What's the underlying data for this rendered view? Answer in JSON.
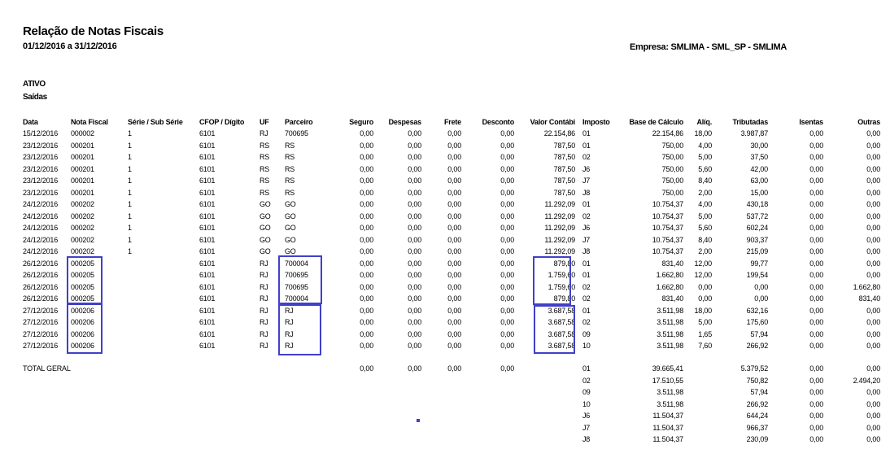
{
  "report": {
    "title": "Relação de Notas Fiscais",
    "period": "01/12/2016 a 31/12/2016",
    "company": "Empresa: SMLIMA - SML_SP - SMLIMA",
    "section": "ATIVO",
    "subsection": "Saídas"
  },
  "table": {
    "columns": [
      "Data",
      "Nota Fiscal",
      "Série / Sub Série",
      "CFOP / Dígito",
      "UF",
      "Parceiro",
      "Seguro",
      "Despesas",
      "Frete",
      "Desconto",
      "Valor Contábi",
      "Imposto",
      "Base de Cálculo",
      "Alíq.",
      "Tributadas",
      "Isentas",
      "Outras"
    ],
    "rows": [
      [
        "15/12/2016",
        "000002",
        "1",
        "6101",
        "RJ",
        "700695",
        "0,00",
        "0,00",
        "0,00",
        "0,00",
        "22.154,86",
        "01",
        "22.154,86",
        "18,00",
        "3.987,87",
        "0,00",
        "0,00"
      ],
      [
        "23/12/2016",
        "000201",
        "1",
        "6101",
        "RS",
        "RS",
        "0,00",
        "0,00",
        "0,00",
        "0,00",
        "787,50",
        "01",
        "750,00",
        "4,00",
        "30,00",
        "0,00",
        "0,00"
      ],
      [
        "23/12/2016",
        "000201",
        "1",
        "6101",
        "RS",
        "RS",
        "0,00",
        "0,00",
        "0,00",
        "0,00",
        "787,50",
        "02",
        "750,00",
        "5,00",
        "37,50",
        "0,00",
        "0,00"
      ],
      [
        "23/12/2016",
        "000201",
        "1",
        "6101",
        "RS",
        "RS",
        "0,00",
        "0,00",
        "0,00",
        "0,00",
        "787,50",
        "J6",
        "750,00",
        "5,60",
        "42,00",
        "0,00",
        "0,00"
      ],
      [
        "23/12/2016",
        "000201",
        "1",
        "6101",
        "RS",
        "RS",
        "0,00",
        "0,00",
        "0,00",
        "0,00",
        "787,50",
        "J7",
        "750,00",
        "8,40",
        "63,00",
        "0,00",
        "0,00"
      ],
      [
        "23/12/2016",
        "000201",
        "1",
        "6101",
        "RS",
        "RS",
        "0,00",
        "0,00",
        "0,00",
        "0,00",
        "787,50",
        "J8",
        "750,00",
        "2,00",
        "15,00",
        "0,00",
        "0,00"
      ],
      [
        "24/12/2016",
        "000202",
        "1",
        "6101",
        "GO",
        "GO",
        "0,00",
        "0,00",
        "0,00",
        "0,00",
        "11.292,09",
        "01",
        "10.754,37",
        "4,00",
        "430,18",
        "0,00",
        "0,00"
      ],
      [
        "24/12/2016",
        "000202",
        "1",
        "6101",
        "GO",
        "GO",
        "0,00",
        "0,00",
        "0,00",
        "0,00",
        "11.292,09",
        "02",
        "10.754,37",
        "5,00",
        "537,72",
        "0,00",
        "0,00"
      ],
      [
        "24/12/2016",
        "000202",
        "1",
        "6101",
        "GO",
        "GO",
        "0,00",
        "0,00",
        "0,00",
        "0,00",
        "11.292,09",
        "J6",
        "10.754,37",
        "5,60",
        "602,24",
        "0,00",
        "0,00"
      ],
      [
        "24/12/2016",
        "000202",
        "1",
        "6101",
        "GO",
        "GO",
        "0,00",
        "0,00",
        "0,00",
        "0,00",
        "11.292,09",
        "J7",
        "10.754,37",
        "8,40",
        "903,37",
        "0,00",
        "0,00"
      ],
      [
        "24/12/2016",
        "000202",
        "1",
        "6101",
        "GO",
        "GO",
        "0,00",
        "0,00",
        "0,00",
        "0,00",
        "11.292,09",
        "J8",
        "10.754,37",
        "2,00",
        "215,09",
        "0,00",
        "0,00"
      ],
      [
        "26/12/2016",
        "000205",
        "",
        "6101",
        "RJ",
        "700004",
        "0,00",
        "0,00",
        "0,00",
        "0,00",
        "879,80",
        "01",
        "831,40",
        "12,00",
        "99,77",
        "0,00",
        "0,00"
      ],
      [
        "26/12/2016",
        "000205",
        "",
        "6101",
        "RJ",
        "700695",
        "0,00",
        "0,00",
        "0,00",
        "0,00",
        "1.759,60",
        "01",
        "1.662,80",
        "12,00",
        "199,54",
        "0,00",
        "0,00"
      ],
      [
        "26/12/2016",
        "000205",
        "",
        "6101",
        "RJ",
        "700695",
        "0,00",
        "0,00",
        "0,00",
        "0,00",
        "1.759,60",
        "02",
        "1.662,80",
        "0,00",
        "0,00",
        "0,00",
        "1.662,80"
      ],
      [
        "26/12/2016",
        "000205",
        "",
        "6101",
        "RJ",
        "700004",
        "0,00",
        "0,00",
        "0,00",
        "0,00",
        "879,80",
        "02",
        "831,40",
        "0,00",
        "0,00",
        "0,00",
        "831,40"
      ],
      [
        "27/12/2016",
        "000206",
        "",
        "6101",
        "RJ",
        "RJ",
        "0,00",
        "0,00",
        "0,00",
        "0,00",
        "3.687,58",
        "01",
        "3.511,98",
        "18,00",
        "632,16",
        "0,00",
        "0,00"
      ],
      [
        "27/12/2016",
        "000206",
        "",
        "6101",
        "RJ",
        "RJ",
        "0,00",
        "0,00",
        "0,00",
        "0,00",
        "3.687,58",
        "02",
        "3.511,98",
        "5,00",
        "175,60",
        "0,00",
        "0,00"
      ],
      [
        "27/12/2016",
        "000206",
        "",
        "6101",
        "RJ",
        "RJ",
        "0,00",
        "0,00",
        "0,00",
        "0,00",
        "3.687,58",
        "09",
        "3.511,98",
        "1,65",
        "57,94",
        "0,00",
        "0,00"
      ],
      [
        "27/12/2016",
        "000206",
        "",
        "6101",
        "RJ",
        "RJ",
        "0,00",
        "0,00",
        "0,00",
        "0,00",
        "3.687,58",
        "10",
        "3.511,98",
        "7,60",
        "266,92",
        "0,00",
        "0,00"
      ]
    ]
  },
  "totals": {
    "label": "TOTAL GERAL",
    "seguro": "0,00",
    "despesas": "0,00",
    "frete": "0,00",
    "desconto": "0,00",
    "rows": [
      [
        "01",
        "39.665,41",
        "5.379,52",
        "0,00",
        "0,00"
      ],
      [
        "02",
        "17.510,55",
        "750,82",
        "0,00",
        "2.494,20"
      ],
      [
        "09",
        "3.511,98",
        "57,94",
        "0,00",
        "0,00"
      ],
      [
        "10",
        "3.511,98",
        "266,92",
        "0,00",
        "0,00"
      ],
      [
        "J6",
        "11.504,37",
        "644,24",
        "0,00",
        "0,00"
      ],
      [
        "J7",
        "11.504,37",
        "966,37",
        "0,00",
        "0,00"
      ],
      [
        "J8",
        "11.504,37",
        "230,09",
        "0,00",
        "0,00"
      ]
    ]
  },
  "colors": {
    "highlight": "#4040c8"
  }
}
